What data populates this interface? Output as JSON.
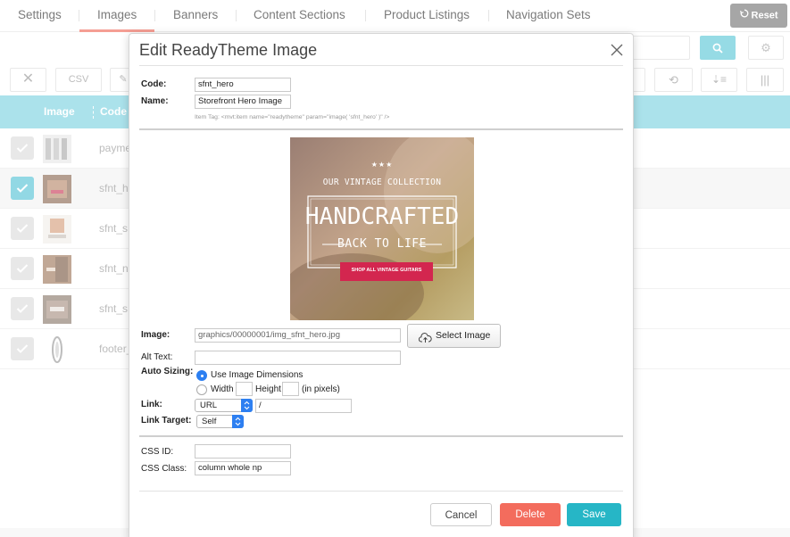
{
  "nav": {
    "tabs": [
      {
        "label": "Settings"
      },
      {
        "label": "Images"
      },
      {
        "label": "Banners"
      },
      {
        "label": "Content Sections"
      },
      {
        "label": "Product Listings"
      },
      {
        "label": "Navigation Sets"
      }
    ],
    "active_tab": "Images",
    "reset_label": "Reset"
  },
  "toolbar": {
    "csv_label": "CSV"
  },
  "table": {
    "columns": [
      "Image",
      "Code"
    ],
    "rows": [
      {
        "code": "payme",
        "selected": false
      },
      {
        "code": "sfnt_h",
        "selected": true
      },
      {
        "code": "sfnt_s",
        "selected": false
      },
      {
        "code": "sfnt_n",
        "selected": false
      },
      {
        "code": "sfnt_s",
        "selected": false
      },
      {
        "code": "footer_",
        "selected": false
      }
    ]
  },
  "modal": {
    "title": "Edit ReadyTheme Image",
    "code_label": "Code:",
    "code_value": "sfnt_hero",
    "name_label": "Name:",
    "name_value": "Storefront Hero Image",
    "item_tag": "Item Tag: <mvt:item name=\"readytheme\" param=\"image( 'sfnt_hero' )\" />",
    "hero": {
      "stars": "★★★",
      "line1": "OUR VINTAGE COLLECTION",
      "line2": "HANDCRAFTED",
      "line3": "BACK TO LIFE",
      "cta": "SHOP ALL VINTAGE GUITARS"
    },
    "image_label": "Image:",
    "image_value": "graphics/00000001/img_sfnt_hero.jpg",
    "select_image_label": "Select Image",
    "alt_text_label": "Alt Text:",
    "alt_text_value": "",
    "auto_sizing_label": "Auto Sizing:",
    "use_dims_label": "Use Image Dimensions",
    "width_label": "Width",
    "height_label": "Height",
    "pixels_label": "(in pixels)",
    "link_label": "Link:",
    "link_type": "URL",
    "link_value": "/",
    "link_target_label": "Link Target:",
    "link_target_value": "Self",
    "css_id_label": "CSS ID:",
    "css_id_value": "",
    "css_class_label": "CSS Class:",
    "css_class_value": "column whole np",
    "cancel_label": "Cancel",
    "delete_label": "Delete",
    "save_label": "Save"
  },
  "colors": {
    "accent": "#26b6c6",
    "header_row": "#7fd3e0",
    "delete": "#f36c5d",
    "active_tab_underline": "#f06a5b"
  }
}
